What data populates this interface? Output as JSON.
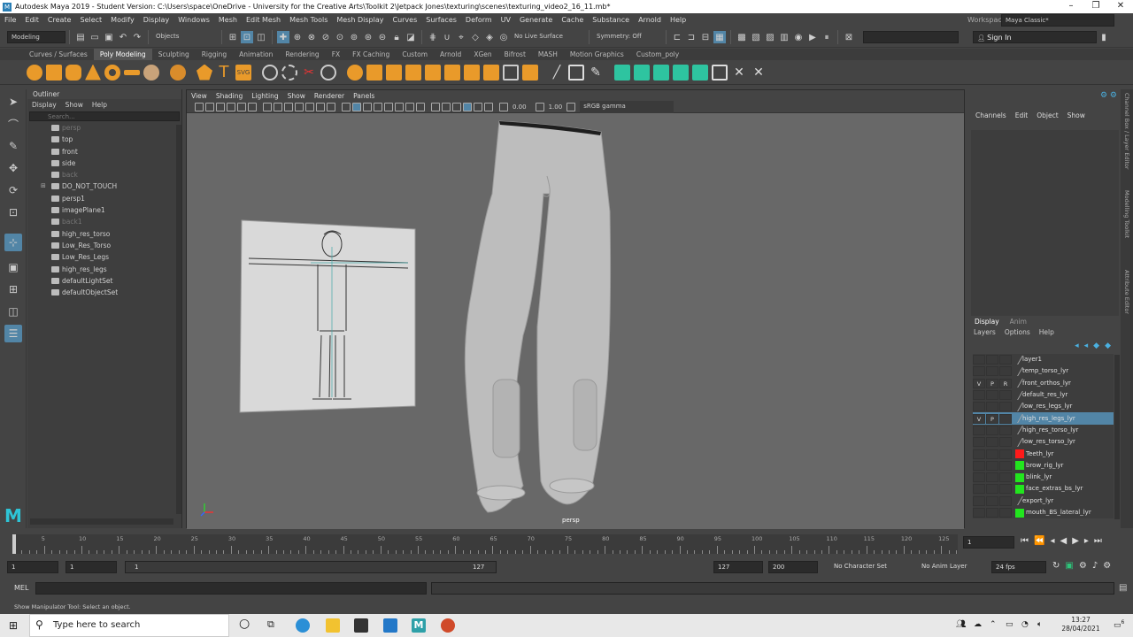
{
  "window": {
    "title": "Autodesk Maya 2019 - Student Version: C:\\Users\\space\\OneDrive - University for the Creative Arts\\Toolkit 2\\Jetpack Jones\\texturing\\scenes\\texturing_video2_16_11.mb*",
    "controls": [
      "–",
      "❐",
      "✕"
    ]
  },
  "menubar": [
    "File",
    "Edit",
    "Create",
    "Select",
    "Modify",
    "Display",
    "Windows",
    "Mesh",
    "Edit Mesh",
    "Mesh Tools",
    "Mesh Display",
    "Curves",
    "Surfaces",
    "Deform",
    "UV",
    "Generate",
    "Cache",
    "Substance",
    "Arnold",
    "Help"
  ],
  "workspace": {
    "label": "Workspace :",
    "value": "Maya Classic*"
  },
  "statusline": {
    "menuset": "Modeling",
    "objects": "Objects",
    "live_surface": "No Live Surface",
    "symmetry": "Symmetry: Off",
    "signin": "Sign In"
  },
  "shelf": {
    "tabs": [
      "Curves / Surfaces",
      "Poly Modeling",
      "Sculpting",
      "Rigging",
      "Animation",
      "Rendering",
      "FX",
      "FX Caching",
      "Custom",
      "Arnold",
      "XGen",
      "Bifrost",
      "MASH",
      "Motion Graphics",
      "Custom_poly"
    ],
    "active_tab": "Poly Modeling"
  },
  "outliner": {
    "title": "Outliner",
    "menu": [
      "Display",
      "Show",
      "Help"
    ],
    "search_placeholder": "Search...",
    "items": [
      {
        "label": "persp",
        "dim": true
      },
      {
        "label": "top",
        "dim": false
      },
      {
        "label": "front",
        "dim": false
      },
      {
        "label": "side",
        "dim": false
      },
      {
        "label": "back",
        "dim": true
      },
      {
        "label": "DO_NOT_TOUCH",
        "dim": false,
        "expand": true
      },
      {
        "label": "persp1",
        "dim": false
      },
      {
        "label": "imagePlane1",
        "dim": false
      },
      {
        "label": "back1",
        "dim": true
      },
      {
        "label": "high_res_torso",
        "dim": false
      },
      {
        "label": "Low_Res_Torso",
        "dim": false
      },
      {
        "label": "Low_Res_Legs",
        "dim": false
      },
      {
        "label": "high_res_legs",
        "dim": false
      },
      {
        "label": "defaultLightSet",
        "dim": false
      },
      {
        "label": "defaultObjectSet",
        "dim": false
      }
    ]
  },
  "viewport": {
    "menu": [
      "View",
      "Shading",
      "Lighting",
      "Show",
      "Renderer",
      "Panels"
    ],
    "exposure": "0.00",
    "gamma": "1.00",
    "color_space": "sRGB gamma",
    "camera": "persp"
  },
  "channelbox": {
    "menu": [
      "Channels",
      "Edit",
      "Object",
      "Show"
    ]
  },
  "side_tabs": [
    "Channel Box / Layer Editor",
    "Modelling Toolkit",
    "Attribute Editor"
  ],
  "layer_editor": {
    "tabs": [
      "Display",
      "Anim"
    ],
    "menu": [
      "Layers",
      "Options",
      "Help"
    ],
    "layers": [
      {
        "v": "",
        "p": "",
        "r": "",
        "name": "layer1",
        "color": "",
        "sel": false
      },
      {
        "v": "",
        "p": "",
        "r": "",
        "name": "temp_torso_lyr",
        "color": "",
        "sel": false
      },
      {
        "v": "V",
        "p": "P",
        "r": "R",
        "name": "front_orthos_lyr",
        "color": "",
        "sel": false
      },
      {
        "v": "",
        "p": "",
        "r": "",
        "name": "default_res_lyr",
        "color": "",
        "sel": false
      },
      {
        "v": "",
        "p": "",
        "r": "",
        "name": "low_res_legs_lyr",
        "color": "",
        "sel": false
      },
      {
        "v": "V",
        "p": "P",
        "r": "",
        "name": "high_res_legs_lyr",
        "color": "",
        "sel": true
      },
      {
        "v": "",
        "p": "",
        "r": "",
        "name": "high_res_torso_lyr",
        "color": "",
        "sel": false
      },
      {
        "v": "",
        "p": "",
        "r": "",
        "name": "low_res_torso_lyr",
        "color": "",
        "sel": false
      },
      {
        "v": "",
        "p": "",
        "r": "",
        "name": "Teeth_lyr",
        "color": "#ff1a1a",
        "sel": false
      },
      {
        "v": "",
        "p": "",
        "r": "",
        "name": "brow_rig_lyr",
        "color": "#22e51e",
        "sel": false
      },
      {
        "v": "",
        "p": "",
        "r": "",
        "name": "blink_lyr",
        "color": "#22e51e",
        "sel": false
      },
      {
        "v": "",
        "p": "",
        "r": "",
        "name": "face_extras_bs_lyr",
        "color": "#22e51e",
        "sel": false
      },
      {
        "v": "",
        "p": "",
        "r": "",
        "name": "export_lyr",
        "color": "",
        "sel": false
      },
      {
        "v": "",
        "p": "",
        "r": "",
        "name": "mouth_BS_lateral_lyr",
        "color": "#22e51e",
        "sel": false
      }
    ]
  },
  "timeslider": {
    "ticks": [
      "5",
      "10",
      "15",
      "20",
      "25",
      "30",
      "35",
      "40",
      "45",
      "50",
      "55",
      "60",
      "65",
      "70",
      "75",
      "80",
      "85",
      "90",
      "95",
      "100",
      "105",
      "110",
      "115",
      "120",
      "125"
    ],
    "current_frame": "1"
  },
  "range": {
    "start": "1",
    "playback_start": "1",
    "slider_start": "1",
    "slider_end": "127",
    "playback_end": "127",
    "end": "200",
    "character_set": "No Character Set",
    "anim_layer": "No Anim Layer",
    "fps": "24 fps"
  },
  "cmdline": {
    "label": "MEL"
  },
  "helpline": {
    "text": "Show Manipulator Tool: Select an object."
  },
  "taskbar": {
    "search": "Type here to search",
    "time": "13:27",
    "date": "28/04/2021",
    "notifications": "6"
  }
}
